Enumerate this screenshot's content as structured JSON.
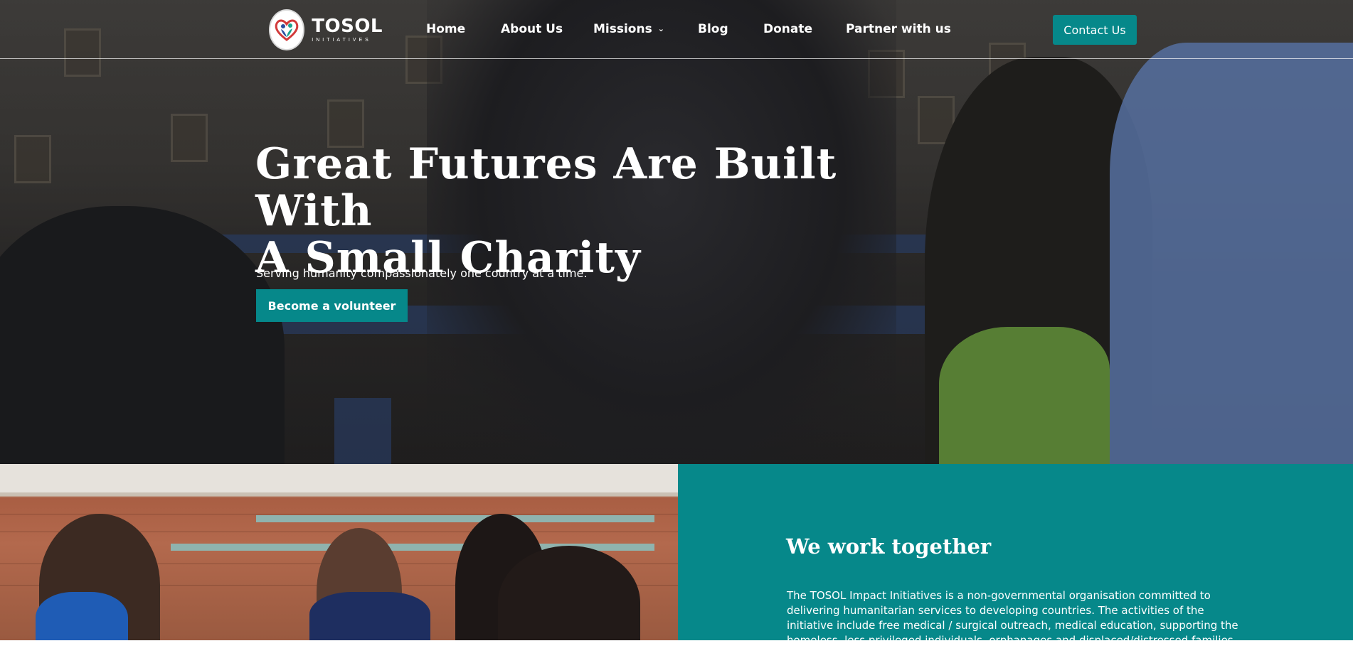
{
  "brand": {
    "name": "TOSOL",
    "tagline": "INITIATIVES"
  },
  "nav": {
    "items": [
      {
        "label": "Home"
      },
      {
        "label": "About Us"
      },
      {
        "label": "Missions",
        "has_dropdown": true
      },
      {
        "label": "Blog"
      },
      {
        "label": "Donate"
      },
      {
        "label": "Partner with us"
      }
    ],
    "contact_label": "Contact Us"
  },
  "hero": {
    "title_line1": "Great Futures Are Built With",
    "title_line2": "A Small Charity",
    "subtitle": "Serving humanity compassionately one country at a time.",
    "cta_label": "Become a volunteer"
  },
  "about": {
    "title": "We work together",
    "body": "The TOSOL Impact Initiatives is a non-governmental organisation committed to delivering humanitarian services to developing countries. The activities of the initiative include free medical / surgical outreach, medical education, supporting the homeless, less privileged individuals, orphanages and displaced/distressed families, supporting"
  },
  "colors": {
    "accent": "#06888a",
    "text_light": "#ffffff"
  },
  "icons": {
    "logo": "heart-people-icon",
    "dropdown": "chevron-down-icon"
  }
}
